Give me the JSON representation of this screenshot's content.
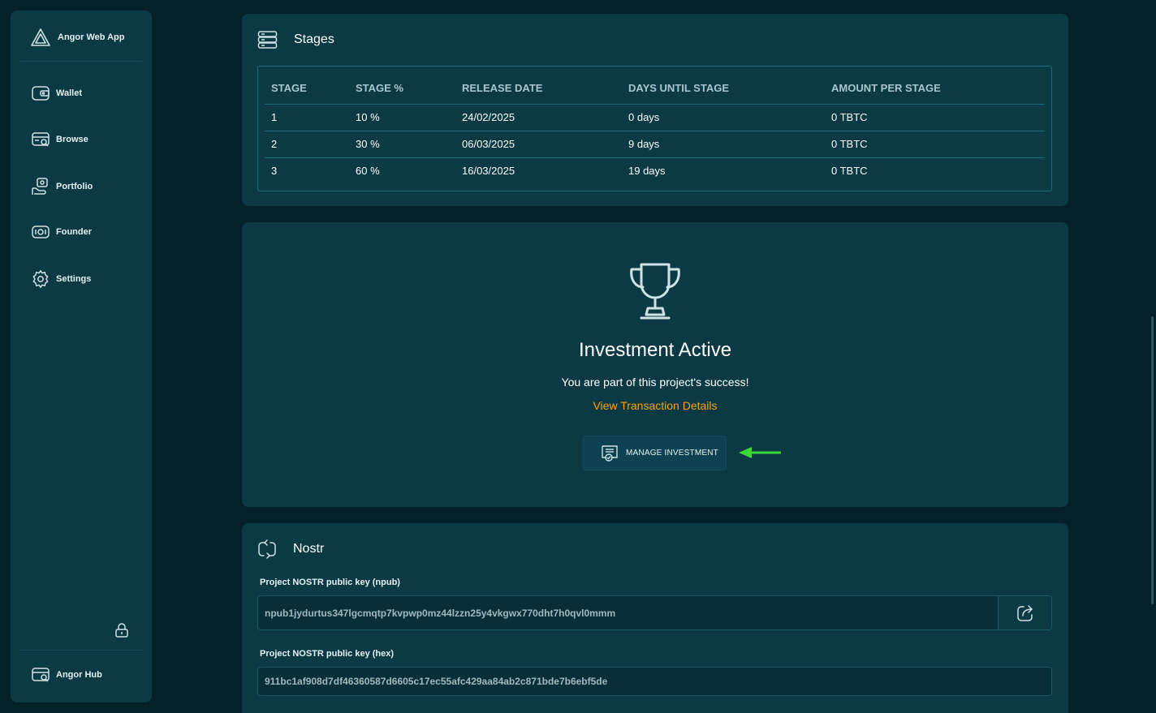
{
  "sidebar": {
    "brand": "Angor Web App",
    "items": [
      {
        "label": "Wallet",
        "icon": "wallet-icon"
      },
      {
        "label": "Browse",
        "icon": "browse-icon"
      },
      {
        "label": "Portfolio",
        "icon": "portfolio-icon"
      },
      {
        "label": "Founder",
        "icon": "founder-icon"
      },
      {
        "label": "Settings",
        "icon": "gear-icon"
      }
    ],
    "footer": "Angor Hub"
  },
  "stages": {
    "title": "Stages",
    "headers": [
      "STAGE",
      "STAGE %",
      "RELEASE DATE",
      "DAYS UNTIL STAGE",
      "AMOUNT PER STAGE"
    ],
    "rows": [
      [
        "1",
        "10 %",
        "24/02/2025",
        "0 days",
        "0 TBTC"
      ],
      [
        "2",
        "30 %",
        "06/03/2025",
        "9 days",
        "0 TBTC"
      ],
      [
        "3",
        "60 %",
        "16/03/2025",
        "19 days",
        "0 TBTC"
      ]
    ]
  },
  "investment": {
    "title": "Investment Active",
    "subtitle": "You are part of this project's success!",
    "link": "View Transaction Details",
    "manage_label": "MANAGE INVESTMENT"
  },
  "nostr": {
    "title": "Nostr",
    "npub_label": "Project NOSTR public key (npub)",
    "npub_value": "npub1jydurtus347lgcmqtp7kvpwp0mz44lzzn25y4vkgwx770dht7h0qvl0mmm",
    "hex_label": "Project NOSTR public key (hex)",
    "hex_value": "911bc1af908d7df46360587d6605c17ec55afc429aa84ab2c871bde7b6ebf5de"
  },
  "colors": {
    "accent": "#f7a21a",
    "arrow": "#39d93a",
    "card": "#0b3a44",
    "background": "#032127"
  }
}
